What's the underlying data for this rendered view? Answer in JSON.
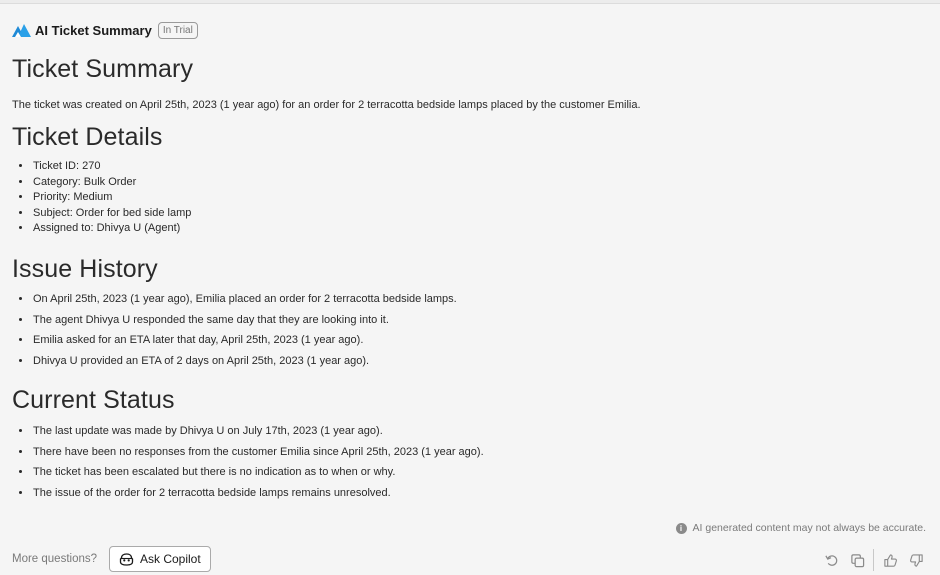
{
  "header": {
    "app_title": "AI Ticket Summary",
    "badge": "In Trial",
    "logo_icon": "mountain-logo",
    "logo_color": "#1f8ad6"
  },
  "sections": {
    "summary": {
      "title": "Ticket Summary",
      "text": "The ticket was created on April 25th, 2023 (1 year ago) for an order for 2 terracotta bedside lamps placed by the customer Emilia."
    },
    "details": {
      "title": "Ticket Details",
      "items": [
        "Ticket ID: 270",
        "Category: Bulk Order",
        "Priority: Medium",
        "Subject: Order for bed side lamp",
        "Assigned to: Dhivya U (Agent)"
      ]
    },
    "history": {
      "title": "Issue History",
      "items": [
        "On April 25th, 2023 (1 year ago), Emilia placed an order for 2 terracotta bedside lamps.",
        "The agent Dhivya U responded the same day that they are looking into it.",
        "Emilia asked for an ETA later that day, April 25th, 2023 (1 year ago).",
        "Dhivya U provided an ETA of 2 days on April 25th, 2023 (1 year ago)."
      ]
    },
    "status": {
      "title": "Current Status",
      "items": [
        "The last update was made by Dhivya U on July 17th, 2023 (1 year ago).",
        "There have been no responses from the customer Emilia since April 25th, 2023 (1 year ago).",
        "The ticket has been escalated but there is no indication as to when or why.",
        "The issue of the order for 2 terracotta bedside lamps remains unresolved."
      ]
    }
  },
  "footer": {
    "disclaimer": "AI generated content may not always be accurate.",
    "more_questions": "More questions?",
    "ask_copilot": "Ask Copilot",
    "icons": [
      "info-icon",
      "copilot-icon",
      "undo-icon",
      "copy-icon",
      "thumbs-up-icon",
      "thumbs-down-icon"
    ]
  }
}
